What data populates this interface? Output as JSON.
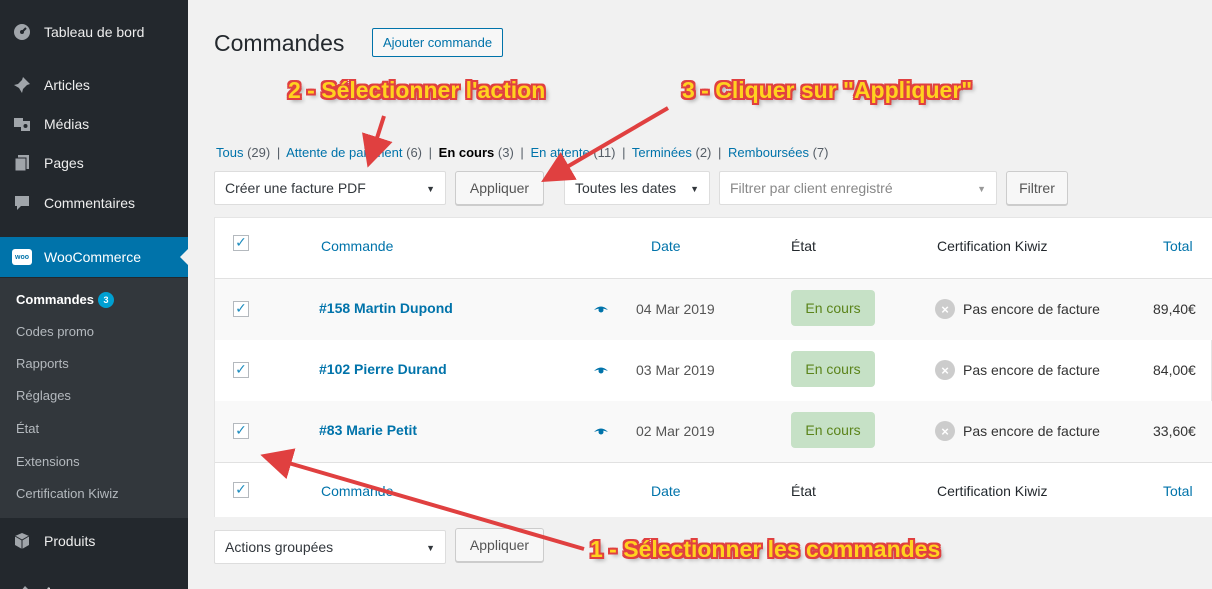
{
  "sidebar": {
    "items": [
      {
        "label": "Tableau de bord",
        "icon": "dashboard-icon"
      },
      {
        "label": "Articles",
        "icon": "pin-icon"
      },
      {
        "label": "Médias",
        "icon": "media-icon"
      },
      {
        "label": "Pages",
        "icon": "pages-icon"
      },
      {
        "label": "Commentaires",
        "icon": "comment-icon"
      },
      {
        "label": "WooCommerce",
        "icon": "woocommerce-icon"
      },
      {
        "label": "Produits",
        "icon": "products-icon"
      },
      {
        "label": "A",
        "icon": "appearance-icon"
      }
    ],
    "woo_logo_text": "woo",
    "submenu": [
      {
        "label": "Commandes",
        "badge": "3"
      },
      {
        "label": "Codes promo"
      },
      {
        "label": "Rapports"
      },
      {
        "label": "Réglages"
      },
      {
        "label": "État"
      },
      {
        "label": "Extensions"
      },
      {
        "label": "Certification Kiwiz"
      }
    ]
  },
  "header": {
    "title": "Commandes",
    "add_button": "Ajouter commande"
  },
  "status_filter": {
    "all": "Tous",
    "all_count": "(29)",
    "pending": "Attente de paiement",
    "pending_count": "(6)",
    "processing": "En cours",
    "processing_count": "(3)",
    "on_hold": "En attente",
    "on_hold_count": "(11)",
    "completed": "Terminées",
    "completed_count": "(2)",
    "refunded": "Remboursées",
    "refunded_count": "(7)",
    "separator": "|"
  },
  "toolbar": {
    "bulk_action_selected": "Créer une facture PDF",
    "apply": "Appliquer",
    "dates": "Toutes les dates",
    "customer_placeholder": "Filtrer par client enregistré",
    "filter": "Filtrer"
  },
  "table": {
    "columns": {
      "order": "Commande",
      "date": "Date",
      "status": "État",
      "cert": "Certification Kiwiz",
      "total": "Total"
    },
    "rows": [
      {
        "order": "#158 Martin Dupond",
        "date": "04 Mar 2019",
        "status": "En cours",
        "cert": "Pas encore de facture",
        "total": "89,40€"
      },
      {
        "order": "#102 Pierre Durand",
        "date": "03 Mar 2019",
        "status": "En cours",
        "cert": "Pas encore de facture",
        "total": "84,00€"
      },
      {
        "order": "#83 Marie Petit",
        "date": "02 Mar 2019",
        "status": "En cours",
        "cert": "Pas encore de facture",
        "total": "33,60€"
      }
    ]
  },
  "bottom_toolbar": {
    "bulk_action_selected": "Actions groupées",
    "apply": "Appliquer"
  },
  "annotations": {
    "step1": "1 - Sélectionner les commandes",
    "step2": "2  - Sélectionner l'action",
    "step3": "3 - Cliquer sur \"Appliquer\""
  },
  "colors": {
    "sidebar": "#23282d",
    "accent": "#0073aa",
    "status_bg": "#c6e1c6",
    "status_text": "#5b841b",
    "annotation_fill": "#ffd21f",
    "annotation_outline": "#e04040"
  }
}
